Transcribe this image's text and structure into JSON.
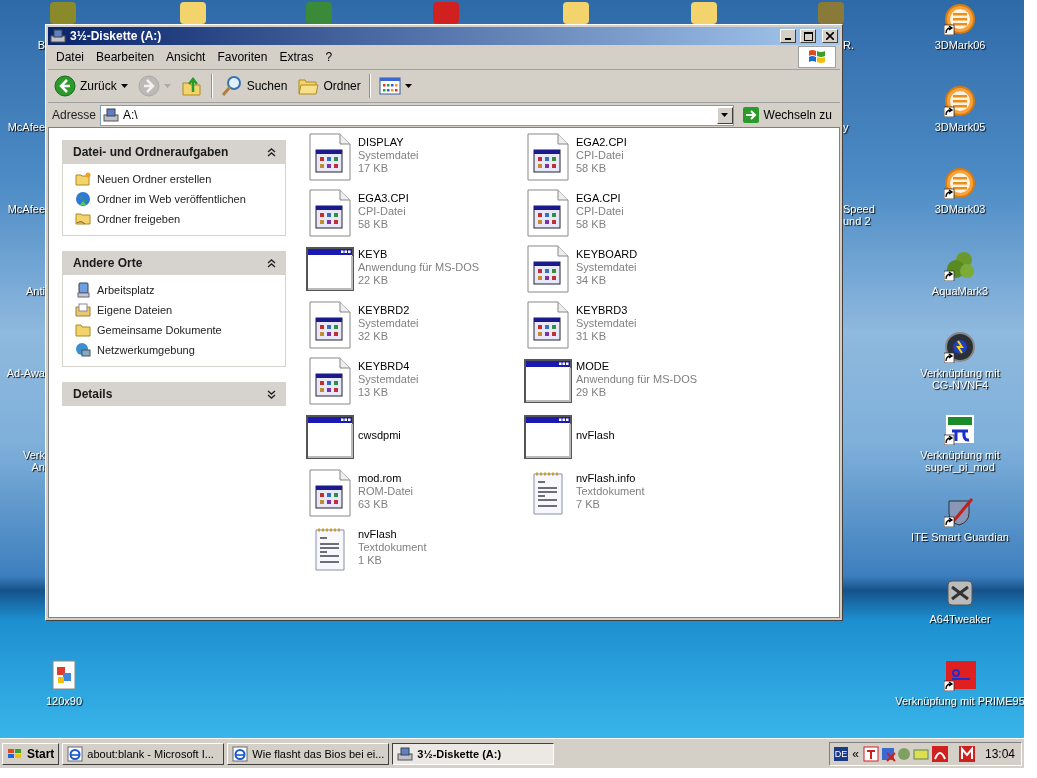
{
  "desktop": {
    "left_labels": [
      {
        "lines": [
          "B"
        ]
      },
      {
        "lines": [
          "McAfee"
        ]
      },
      {
        "lines": [
          "McAfee"
        ]
      },
      {
        "lines": [
          "Anti"
        ]
      },
      {
        "lines": [
          "Ad-Awa"
        ]
      },
      {
        "lines": [
          "Verk",
          "An"
        ]
      }
    ],
    "right_partial_labels": [
      {
        "lines": [
          "R."
        ]
      },
      {
        "lines": [
          "y"
        ]
      },
      {
        "lines": [
          "Speed",
          "und 2"
        ]
      }
    ],
    "right_icons": [
      {
        "kind": "orb",
        "shortcut": true,
        "lines": [
          "3DMark06"
        ]
      },
      {
        "kind": "orb",
        "shortcut": true,
        "lines": [
          "3DMark05"
        ]
      },
      {
        "kind": "orb",
        "shortcut": true,
        "lines": [
          "3DMark03"
        ]
      },
      {
        "kind": "am",
        "shortcut": true,
        "lines": [
          "AquaMark3"
        ]
      },
      {
        "kind": "gauge",
        "shortcut": true,
        "lines": [
          "Verknüpfung mit",
          "CG-NVNF4"
        ]
      },
      {
        "kind": "super",
        "shortcut": true,
        "lines": [
          "Verknüpfung mit",
          "super_pi_mod"
        ]
      },
      {
        "kind": "shield",
        "shortcut": true,
        "lines": [
          "ITE Smart Guardian"
        ]
      },
      {
        "kind": "tweaker",
        "shortcut": false,
        "lines": [
          "A64Tweaker"
        ]
      },
      {
        "kind": "prime",
        "shortcut": true,
        "lines": [
          "Verknüpfung mit PRIME95"
        ]
      }
    ],
    "bottom_icons": [
      {
        "kind": "image",
        "shortcut": false,
        "lines": [
          "120x90"
        ]
      }
    ]
  },
  "window": {
    "title": "3½-Diskette (A:)",
    "menu": [
      "Datei",
      "Bearbeiten",
      "Ansicht",
      "Favoriten",
      "Extras",
      "?"
    ],
    "toolbar": [
      {
        "kind": "back",
        "label": "Zurück",
        "disabled": false
      },
      {
        "kind": "forward",
        "disabled": true
      },
      {
        "kind": "up",
        "disabled": false
      },
      {
        "kind": "search",
        "label": "Suchen",
        "disabled": false
      },
      {
        "kind": "folders",
        "label": "Ordner",
        "disabled": false
      },
      {
        "kind": "views",
        "disabled": false
      }
    ],
    "address": {
      "label": "Adresse",
      "value": "A:\\",
      "go": "Wechseln zu"
    },
    "task_panes": [
      {
        "title": "Datei- und Ordneraufgaben",
        "expanded": true,
        "items": [
          {
            "kind": "new-folder",
            "label": "Neuen Ordner erstellen"
          },
          {
            "kind": "web",
            "label": "Ordner im Web veröffentlichen"
          },
          {
            "kind": "share",
            "label": "Ordner freigeben"
          }
        ]
      },
      {
        "title": "Andere Orte",
        "expanded": true,
        "items": [
          {
            "kind": "computer",
            "label": "Arbeitsplatz"
          },
          {
            "kind": "documents",
            "label": "Eigene Dateien"
          },
          {
            "kind": "folder",
            "label": "Gemeinsame Dokumente"
          },
          {
            "kind": "network",
            "label": "Netzwerkumgebung"
          }
        ]
      },
      {
        "title": "Details",
        "expanded": false
      }
    ],
    "files": [
      {
        "kind": "system",
        "name": "DISPLAY",
        "type": "Systemdatei",
        "size": "17 KB"
      },
      {
        "kind": "system",
        "name": "EGA2.CPI",
        "type": "CPI-Datei",
        "size": "58 KB"
      },
      {
        "kind": "system",
        "name": "EGA3.CPI",
        "type": "CPI-Datei",
        "size": "58 KB"
      },
      {
        "kind": "system",
        "name": "EGA.CPI",
        "type": "CPI-Datei",
        "size": "58 KB"
      },
      {
        "kind": "app",
        "name": "KEYB",
        "type": "Anwendung für MS-DOS",
        "size": "22 KB"
      },
      {
        "kind": "system",
        "name": "KEYBOARD",
        "type": "Systemdatei",
        "size": "34 KB"
      },
      {
        "kind": "system",
        "name": "KEYBRD2",
        "type": "Systemdatei",
        "size": "32 KB"
      },
      {
        "kind": "system",
        "name": "KEYBRD3",
        "type": "Systemdatei",
        "size": "31 KB"
      },
      {
        "kind": "system",
        "name": "KEYBRD4",
        "type": "Systemdatei",
        "size": "13 KB"
      },
      {
        "kind": "app",
        "name": "MODE",
        "type": "Anwendung für MS-DOS",
        "size": "29 KB"
      },
      {
        "kind": "app",
        "name": "cwsdpmi"
      },
      {
        "kind": "app",
        "name": "nvFlash"
      },
      {
        "kind": "system",
        "name": "mod.rom",
        "type": "ROM-Datei",
        "size": "63 KB"
      },
      {
        "kind": "text",
        "name": "nvFlash.info",
        "type": "Textdokument",
        "size": "7 KB"
      },
      {
        "kind": "text",
        "name": "nvFlash",
        "type": "Textdokument",
        "size": "1 KB"
      }
    ]
  },
  "taskbar": {
    "start": "Start",
    "tasks": [
      {
        "kind": "browser",
        "label": "about:blank - Microsoft I...",
        "selected": false
      },
      {
        "kind": "browser",
        "label": "Wie flasht das Bios bei ei...",
        "selected": false
      },
      {
        "kind": "drive",
        "label": "3½-Diskette (A:)",
        "selected": true
      }
    ],
    "language": "DE",
    "chevron": "«",
    "clock": "13:04"
  }
}
